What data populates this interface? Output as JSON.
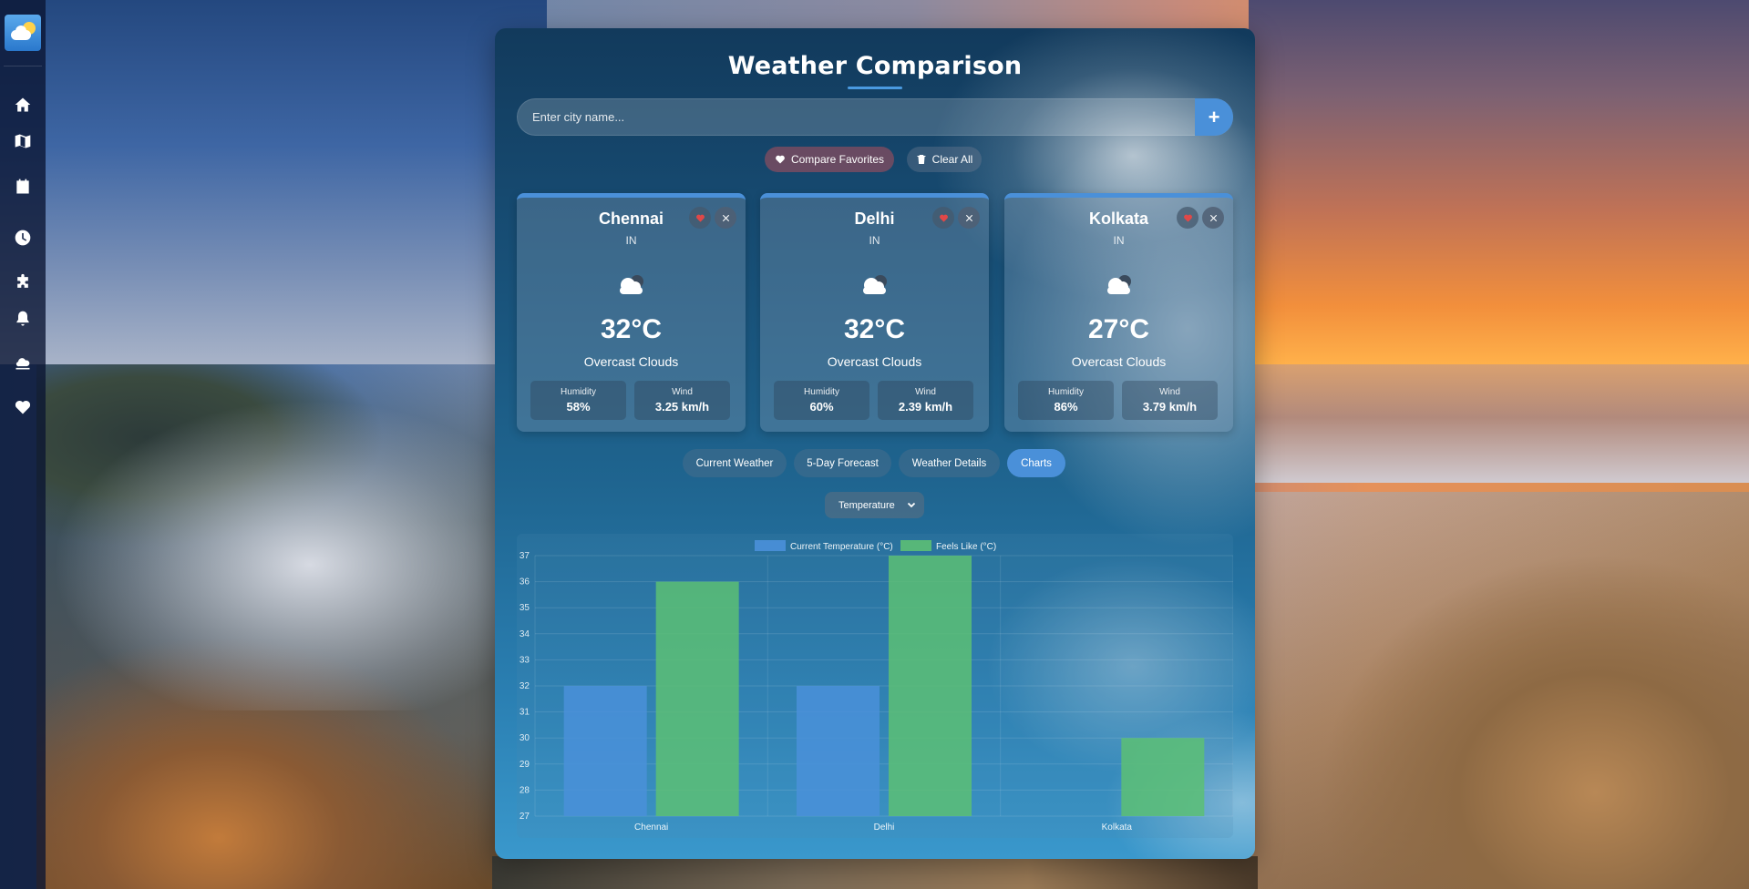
{
  "sidebar": {
    "logo": "weather-logo",
    "items": [
      {
        "name": "home",
        "icon": "home-icon"
      },
      {
        "name": "map",
        "icon": "map-icon"
      },
      {
        "name": "calendar",
        "icon": "calendar-icon"
      },
      {
        "name": "history",
        "icon": "clock-icon"
      },
      {
        "name": "extensions",
        "icon": "puzzle-icon"
      },
      {
        "name": "alerts",
        "icon": "bell-icon"
      },
      {
        "name": "compare",
        "icon": "cloud-sun-icon"
      },
      {
        "name": "favorites",
        "icon": "heart-icon"
      }
    ]
  },
  "header": {
    "title": "Weather Comparison"
  },
  "search": {
    "placeholder": "Enter city name...",
    "add_label": "+"
  },
  "actions": {
    "compare_favorites": "Compare Favorites",
    "clear_all": "Clear All"
  },
  "cities": [
    {
      "name": "Chennai",
      "country": "IN",
      "temp": "32°C",
      "desc": "Overcast Clouds",
      "humidity_label": "Humidity",
      "humidity": "58%",
      "wind_label": "Wind",
      "wind": "3.25 km/h",
      "icon": "overcast-cloud-icon"
    },
    {
      "name": "Delhi",
      "country": "IN",
      "temp": "32°C",
      "desc": "Overcast Clouds",
      "humidity_label": "Humidity",
      "humidity": "60%",
      "wind_label": "Wind",
      "wind": "2.39 km/h",
      "icon": "overcast-cloud-icon"
    },
    {
      "name": "Kolkata",
      "country": "IN",
      "temp": "27°C",
      "desc": "Overcast Clouds",
      "humidity_label": "Humidity",
      "humidity": "86%",
      "wind_label": "Wind",
      "wind": "3.79 km/h",
      "icon": "overcast-cloud-icon"
    }
  ],
  "tabs": [
    {
      "label": "Current Weather",
      "active": false
    },
    {
      "label": "5-Day Forecast",
      "active": false
    },
    {
      "label": "Weather Details",
      "active": false
    },
    {
      "label": "Charts",
      "active": true
    }
  ],
  "chart_select": {
    "selected": "Temperature"
  },
  "colors": {
    "accent": "#4a90d9",
    "series_current": "#4a90d9",
    "series_feels": "#5cbf74",
    "favorite": "#e04848"
  },
  "chart_data": {
    "type": "bar",
    "categories": [
      "Chennai",
      "Delhi",
      "Kolkata"
    ],
    "series": [
      {
        "name": "Current Temperature (°C)",
        "values": [
          32,
          32,
          27
        ]
      },
      {
        "name": "Feels Like (°C)",
        "values": [
          36,
          37,
          30
        ]
      }
    ],
    "ylim": [
      27,
      37
    ],
    "yticks": [
      27,
      28,
      29,
      30,
      31,
      32,
      33,
      34,
      35,
      36,
      37
    ],
    "legend": "top",
    "grid": true
  }
}
